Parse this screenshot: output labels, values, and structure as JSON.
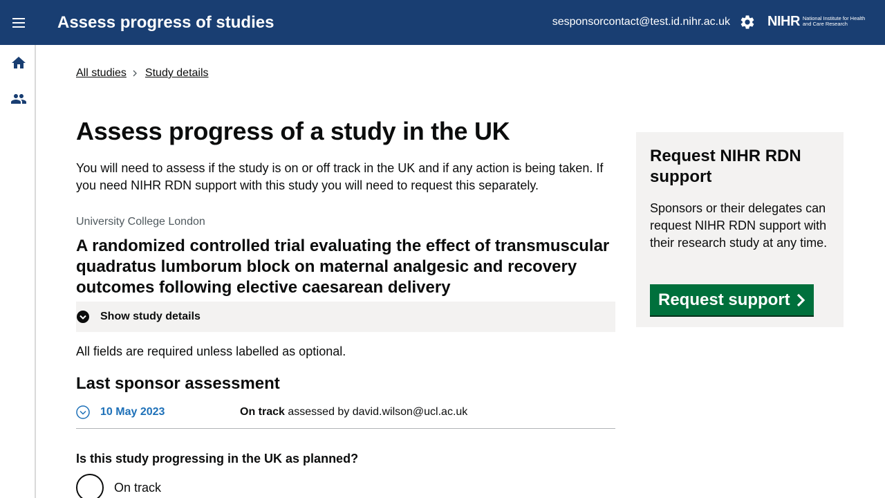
{
  "header": {
    "app_title": "Assess progress of studies",
    "user_email": "sesponsorcontact@test.id.nihr.ac.uk",
    "logo_word": "NIHR",
    "logo_sub": "National Institute for Health and Care Research"
  },
  "breadcrumb": [
    "All studies",
    "Study details"
  ],
  "main": {
    "title": "Assess progress of a study in the UK",
    "intro": "You will need to assess if the study is on or off track in the UK and if any action is being taken. If you need NIHR RDN support with this study you will need to request this separately.",
    "organisation": "University College London",
    "study_title": "A randomized controlled trial evaluating the effect of transmuscular quadratus lumborum block on maternal analgesic and recovery outcomes following elective caesarean delivery",
    "show_details_label": "Show study details",
    "required_note": "All fields are required unless labelled as optional.",
    "last_assessment_heading": "Last sponsor assessment",
    "last_assessment": {
      "date": "10 May 2023",
      "status": "On track",
      "assessed_by_text": "assessed by david.wilson@ucl.ac.uk"
    },
    "question": "Is this study progressing in the UK as planned?",
    "options": [
      "On track"
    ]
  },
  "aside": {
    "heading": "Request NIHR RDN support",
    "body": "Sponsors or their delegates can request NIHR RDN support with their research study at any time.",
    "button_label": "Request support"
  },
  "icons": {
    "menu": "menu-icon",
    "settings": "gear-icon",
    "home": "home-icon",
    "people": "people-icon"
  },
  "colors": {
    "header_bg": "#193e72",
    "button_green": "#00703c",
    "link_blue": "#1d70b8",
    "panel_grey": "#f3f2f1"
  }
}
